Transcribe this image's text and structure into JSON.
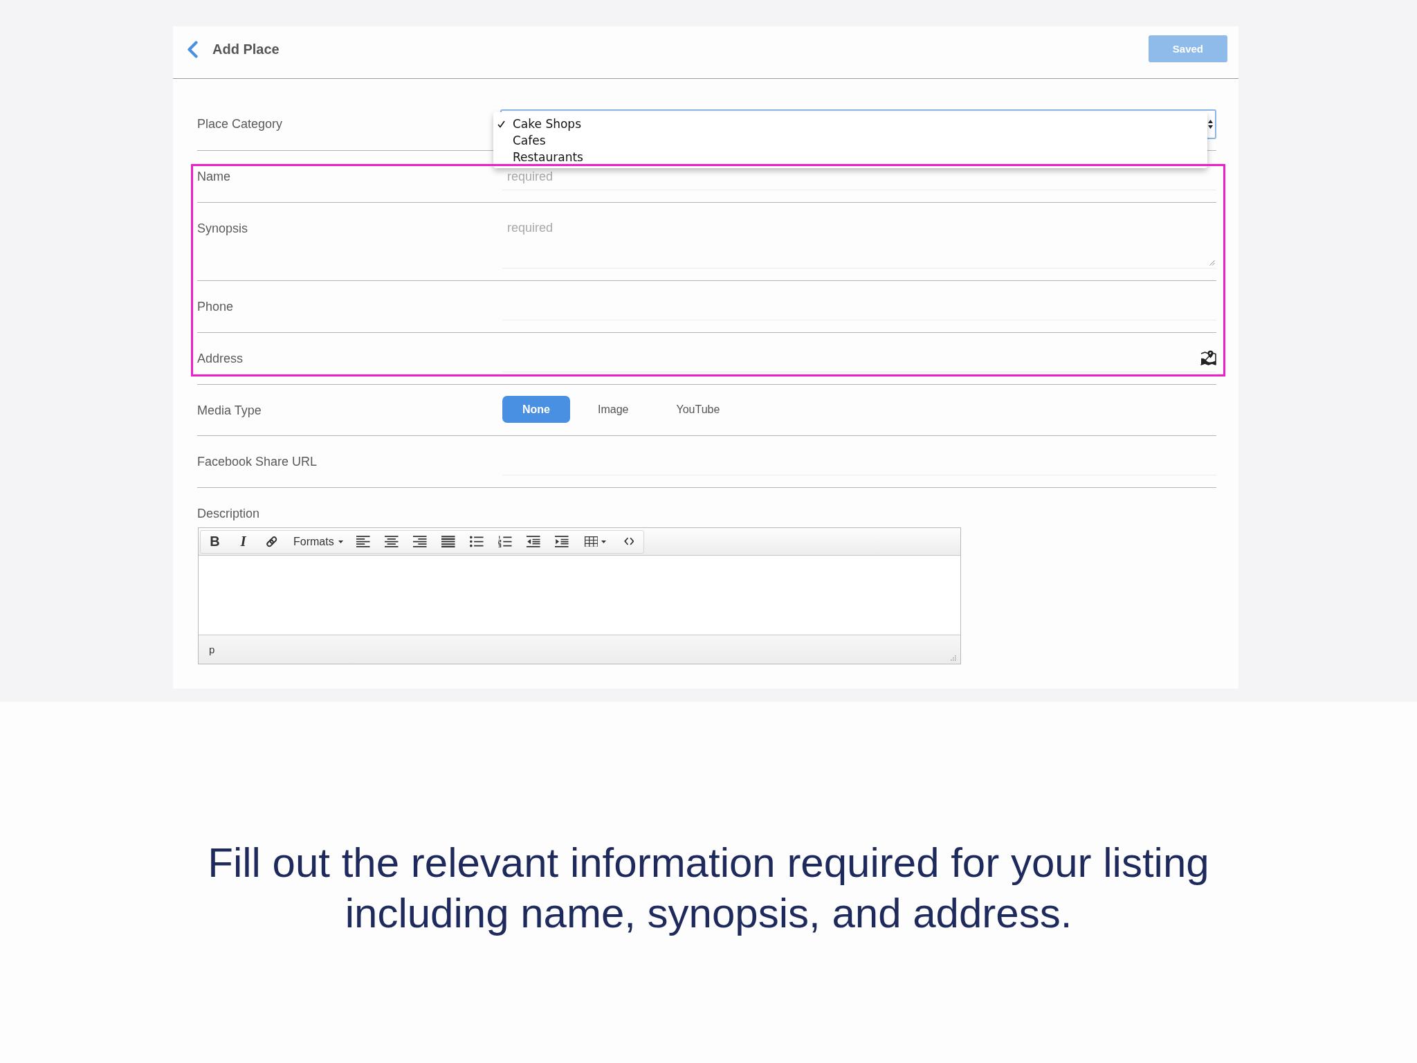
{
  "header": {
    "title": "Add Place",
    "save_button": {
      "label": "Saved",
      "disabled": true
    }
  },
  "form": {
    "rows": [
      {
        "kind": "select",
        "label": "Place Category",
        "highlighted": false,
        "expanded": true,
        "options": [
          {
            "label": "Cake Shops",
            "selected": true
          },
          {
            "label": "Cafes",
            "selected": false
          },
          {
            "label": "Restaurants",
            "selected": false
          }
        ]
      },
      {
        "kind": "input",
        "label": "Name",
        "highlighted": true,
        "placeholder": "required"
      },
      {
        "kind": "textarea",
        "label": "Synopsis",
        "highlighted": true,
        "placeholder": "required"
      },
      {
        "kind": "input",
        "label": "Phone",
        "highlighted": true
      },
      {
        "kind": "address",
        "label": "Address",
        "highlighted": true
      },
      {
        "kind": "segmented",
        "label": "Media Type",
        "highlighted": false,
        "options": [
          {
            "label": "None",
            "selected": true
          },
          {
            "label": "Image",
            "selected": false
          },
          {
            "label": "YouTube",
            "selected": false
          }
        ]
      },
      {
        "kind": "input",
        "label": "Facebook Share URL",
        "highlighted": false
      },
      {
        "kind": "editor",
        "label": "Description",
        "highlighted": false,
        "toolbar": [
          {
            "kind": "bold",
            "label": "B"
          },
          {
            "kind": "italic",
            "label": "I"
          },
          {
            "kind": "link"
          },
          {
            "kind": "formats",
            "label": "Formats"
          },
          {
            "kind": "align-left"
          },
          {
            "kind": "align-center"
          },
          {
            "kind": "align-right"
          },
          {
            "kind": "justify"
          },
          {
            "kind": "bullet-list"
          },
          {
            "kind": "numbered-list"
          },
          {
            "kind": "outdent"
          },
          {
            "kind": "indent"
          },
          {
            "kind": "table"
          },
          {
            "kind": "code"
          }
        ],
        "element_path": "p"
      }
    ]
  },
  "caption": "Fill out the relevant information required for your listing including name, synopsis, and address."
}
